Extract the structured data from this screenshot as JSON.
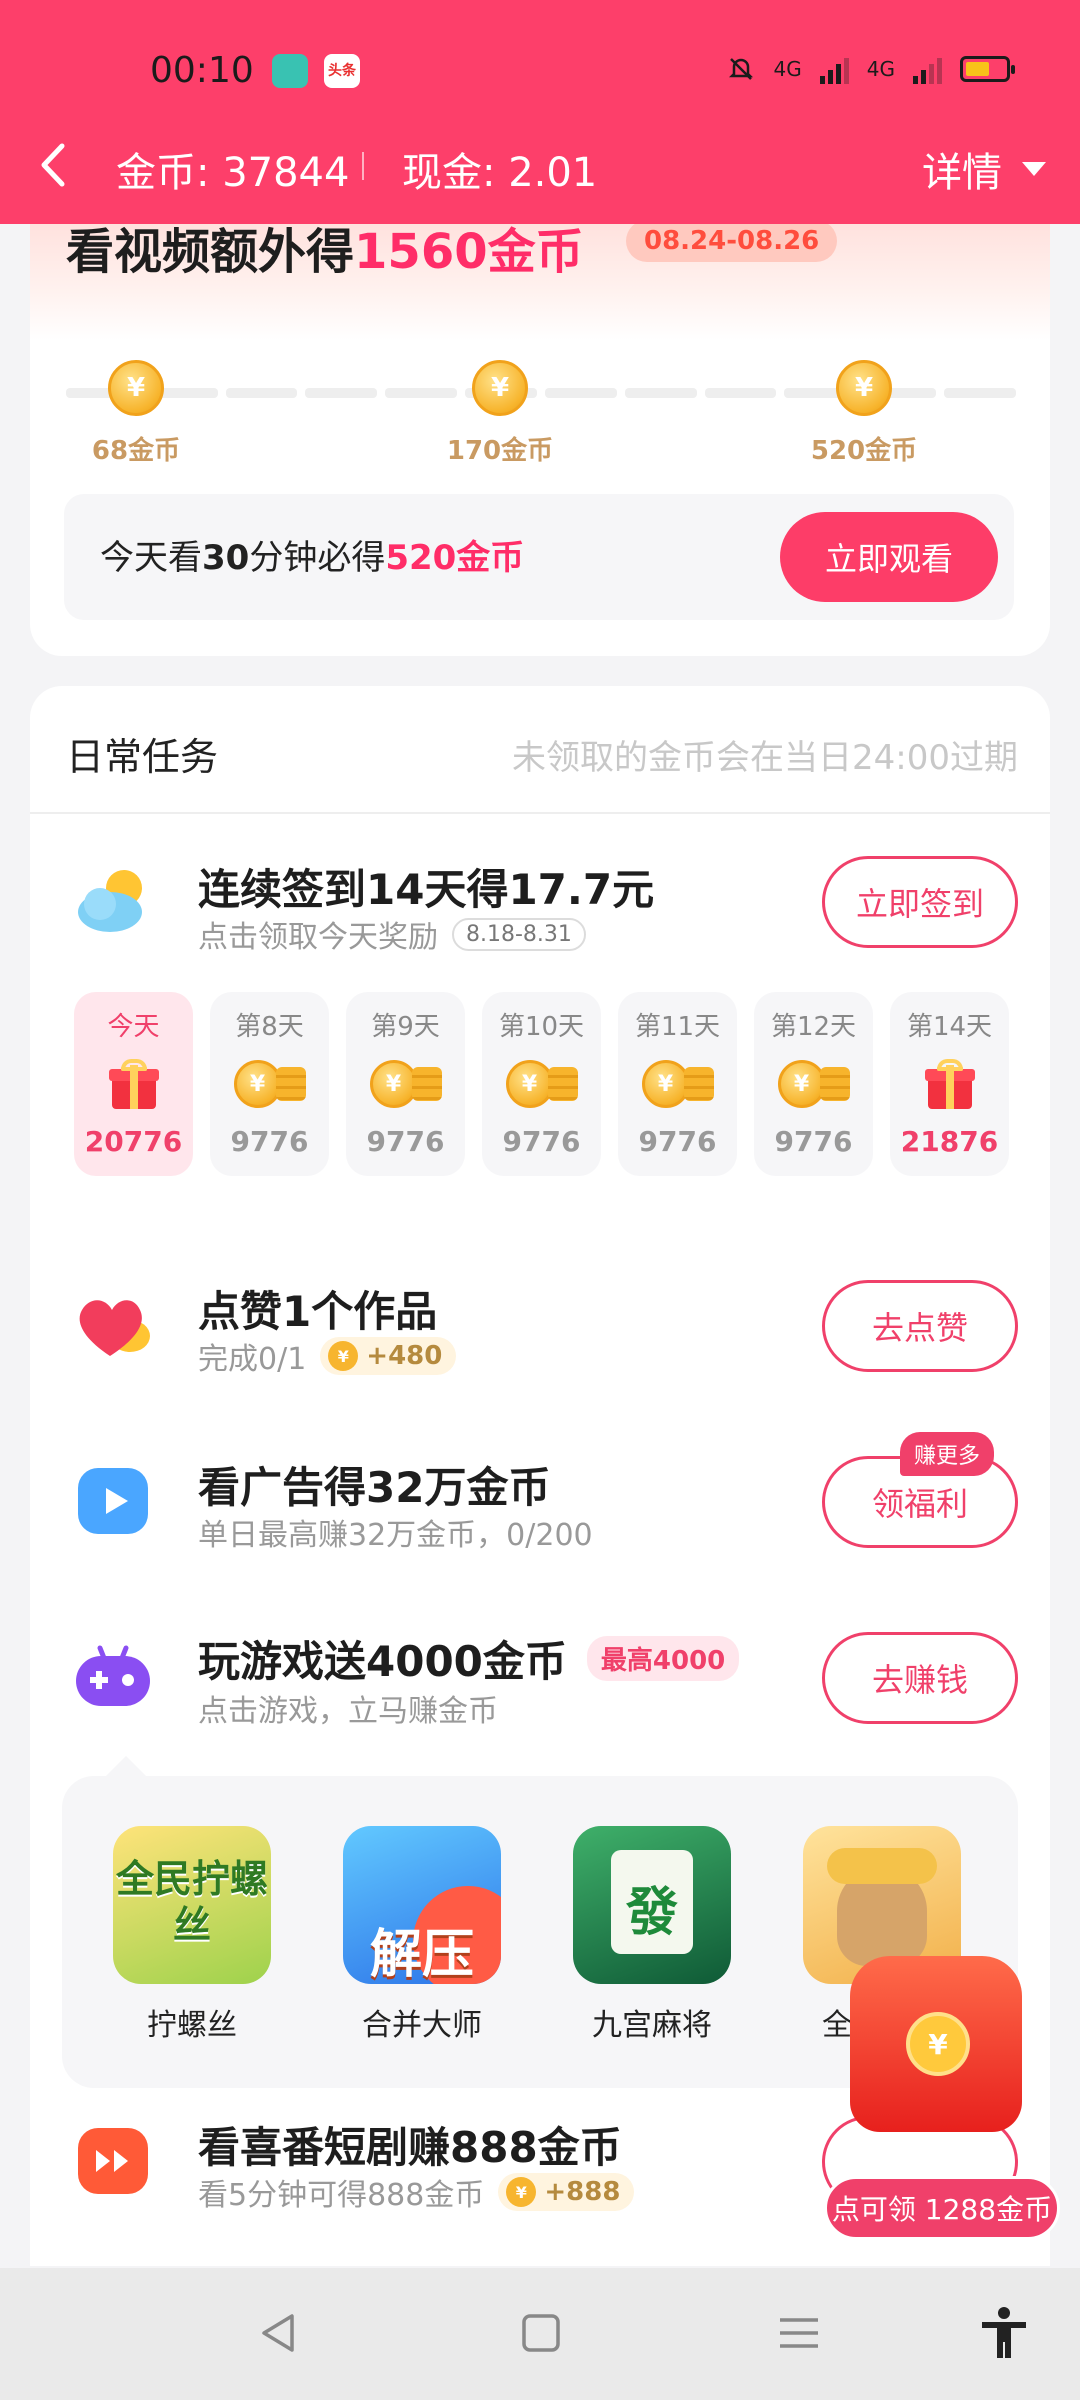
{
  "status_bar": {
    "time": "00:10",
    "app_badge_2": "头条",
    "net1": "4G",
    "net2": "4G"
  },
  "header": {
    "coin_label": "金币: 37844",
    "cash_label": "现金: 2.01",
    "detail_label": "详情"
  },
  "promo": {
    "title_prefix": "看视频额外得",
    "title_highlight": "1560金币",
    "date_range": "08.24-08.26",
    "milestones": [
      "68金币",
      "170金币",
      "520金币"
    ],
    "watch_prefix": "今天看",
    "watch_bold": "30",
    "watch_mid": "分钟必得",
    "watch_highlight": "520金币",
    "watch_button": "立即观看"
  },
  "daily": {
    "title": "日常任务",
    "note": "未领取的金币会在当日24:00过期",
    "checkin": {
      "title": "连续签到14天得17.7元",
      "sub": "点击领取今天奖励",
      "date_pill": "8.18-8.31",
      "button": "立即签到",
      "days": [
        {
          "label": "今天",
          "value": "20776"
        },
        {
          "label": "第8天",
          "value": "9776"
        },
        {
          "label": "第9天",
          "value": "9776"
        },
        {
          "label": "第10天",
          "value": "9776"
        },
        {
          "label": "第11天",
          "value": "9776"
        },
        {
          "label": "第12天",
          "value": "9776"
        },
        {
          "label": "第14天",
          "value": "21876"
        }
      ]
    },
    "like": {
      "title": "点赞1个作品",
      "sub": "完成0/1",
      "reward": "+480",
      "button": "去点赞"
    },
    "ads": {
      "title": "看广告得32万金币",
      "sub": "单日最高赚32万金币，0/200",
      "button": "领福利",
      "badge": "赚更多"
    },
    "games": {
      "title": "玩游戏送4000金币",
      "max_pill": "最高4000",
      "sub": "点击游戏，立马赚金币",
      "button": "去赚钱",
      "items": [
        {
          "name": "拧螺丝",
          "art": "全民拧螺丝"
        },
        {
          "name": "合并大师",
          "art": "解压"
        },
        {
          "name": "九宫麻将",
          "art": "發"
        },
        {
          "name": "全民掼蛋",
          "art": ""
        }
      ]
    },
    "drama": {
      "title": "看喜番短剧赚888金币",
      "sub": "看5分钟可得888金币",
      "reward": "+888"
    }
  },
  "float_reward": {
    "label": "点可领 1288金币"
  },
  "colors": {
    "brand": "#fd3f6a",
    "accent_pink": "#f0406a",
    "coin_gold": "#f7b42c",
    "muted_text": "#999999"
  },
  "icons": [
    "back-arrow-icon",
    "chevron-down-icon",
    "coin-icon",
    "weather-icon",
    "heart-icon",
    "video-play-icon",
    "gamepad-icon",
    "drama-icon",
    "gift-icon",
    "nav-back-icon",
    "nav-home-icon",
    "nav-menu-icon",
    "accessibility-icon"
  ]
}
